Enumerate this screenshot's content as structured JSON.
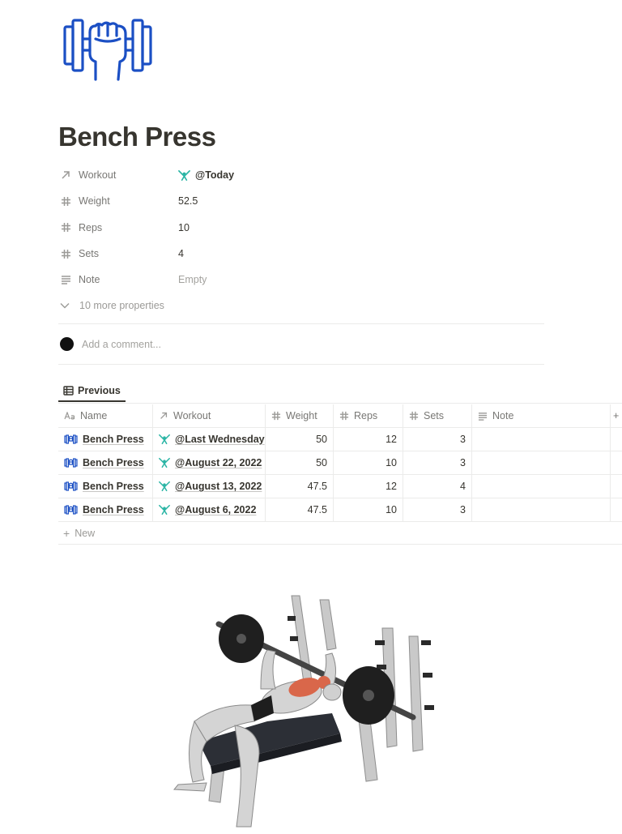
{
  "page": {
    "title": "Bench Press",
    "icon": "dumbbell-fist-icon",
    "accent_color": "#1b4fc4"
  },
  "properties": [
    {
      "icon": "arrow-up-right-icon",
      "label": "Workout",
      "value": "@Today",
      "value_icon": "weightlifter-icon"
    },
    {
      "icon": "hash-icon",
      "label": "Weight",
      "value": "52.5"
    },
    {
      "icon": "hash-icon",
      "label": "Reps",
      "value": "10"
    },
    {
      "icon": "hash-icon",
      "label": "Sets",
      "value": "4"
    },
    {
      "icon": "text-lines-icon",
      "label": "Note",
      "value": "Empty"
    }
  ],
  "more_properties": "10 more properties",
  "comment": {
    "placeholder": "Add a comment..."
  },
  "view_tab": {
    "label": "Previous",
    "icon": "table-icon"
  },
  "table": {
    "columns": [
      {
        "label": "Name",
        "icon": "text-aa-icon"
      },
      {
        "label": "Workout",
        "icon": "arrow-up-right-icon"
      },
      {
        "label": "Weight",
        "icon": "hash-icon"
      },
      {
        "label": "Reps",
        "icon": "hash-icon"
      },
      {
        "label": "Sets",
        "icon": "hash-icon"
      },
      {
        "label": "Note",
        "icon": "text-lines-icon"
      }
    ],
    "add_column": "+",
    "rows": [
      {
        "name": "Bench Press",
        "workout": "@Last Wednesday",
        "weight": "50",
        "reps": "12",
        "sets": "3",
        "note": ""
      },
      {
        "name": "Bench Press",
        "workout": "@August 22, 2022",
        "weight": "50",
        "reps": "10",
        "sets": "3",
        "note": ""
      },
      {
        "name": "Bench Press",
        "workout": "@August 13, 2022",
        "weight": "47.5",
        "reps": "12",
        "sets": "4",
        "note": ""
      },
      {
        "name": "Bench Press",
        "workout": "@August 6, 2022",
        "weight": "47.5",
        "reps": "10",
        "sets": "3",
        "note": ""
      }
    ],
    "new_label": "New"
  },
  "illustration": {
    "name": "bench-press-illustration"
  }
}
